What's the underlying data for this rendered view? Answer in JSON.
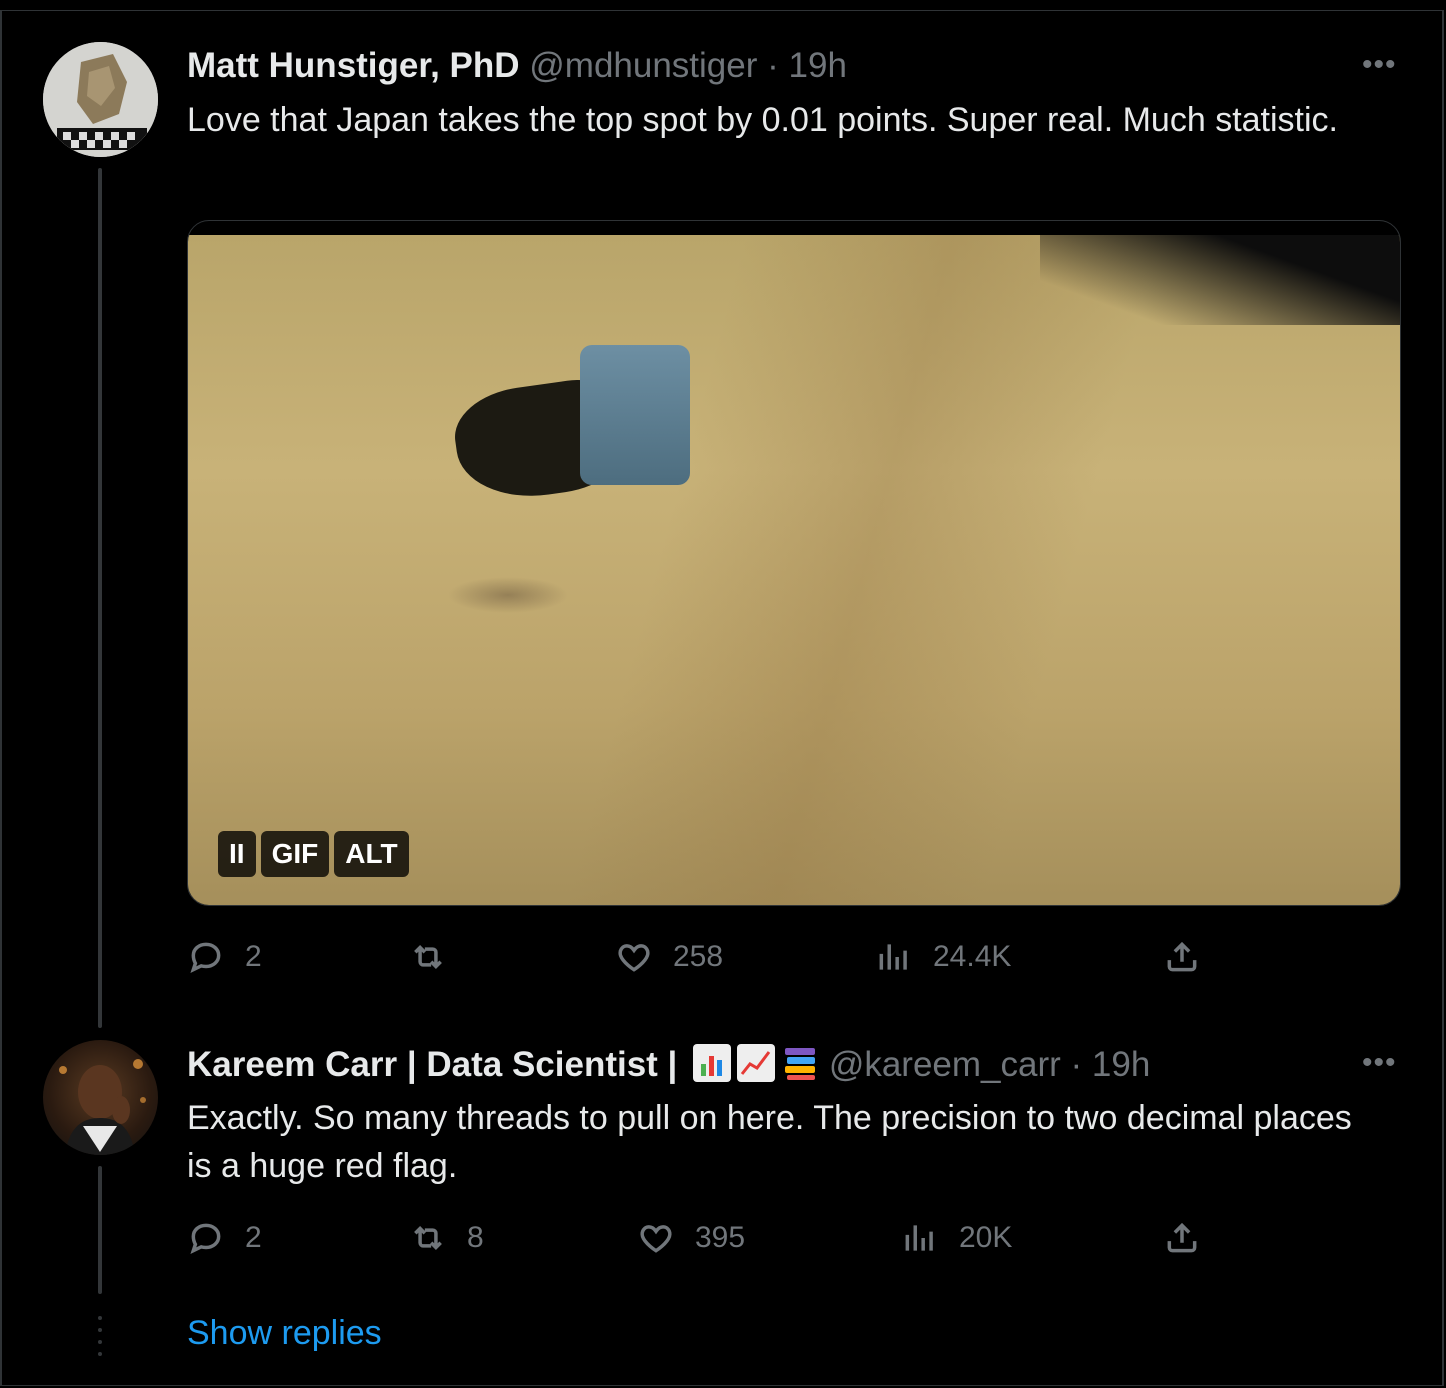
{
  "tweets": [
    {
      "name": "Matt Hunstiger, PhD",
      "handle": "@mdhunstiger",
      "time": "· 19h",
      "text": "Love that Japan takes the top spot by 0.01 points. Super real. Much statistic.",
      "media": {
        "pause_label": "II",
        "gif_label": "GIF",
        "alt_label": "ALT"
      },
      "stats": {
        "replies": "2",
        "retweets": "",
        "likes": "258",
        "views": "24.4K"
      }
    },
    {
      "name": "Kareem Carr | Data Scientist |",
      "name_emojis": [
        "bar-chart-emoji",
        "chart-increasing-emoji",
        "books-emoji"
      ],
      "handle": "@kareem_carr",
      "time": "· 19h",
      "text": "Exactly. So many threads to pull on here. The precision to two decimal places is a huge red flag.",
      "stats": {
        "replies": "2",
        "retweets": "8",
        "likes": "395",
        "views": "20K"
      }
    }
  ],
  "more_label": "•••",
  "show_replies": "Show replies",
  "colors": {
    "background": "#000000",
    "text": "#e7e9ea",
    "muted": "#71767b",
    "link": "#1d9bf0",
    "border": "#2f3336"
  }
}
